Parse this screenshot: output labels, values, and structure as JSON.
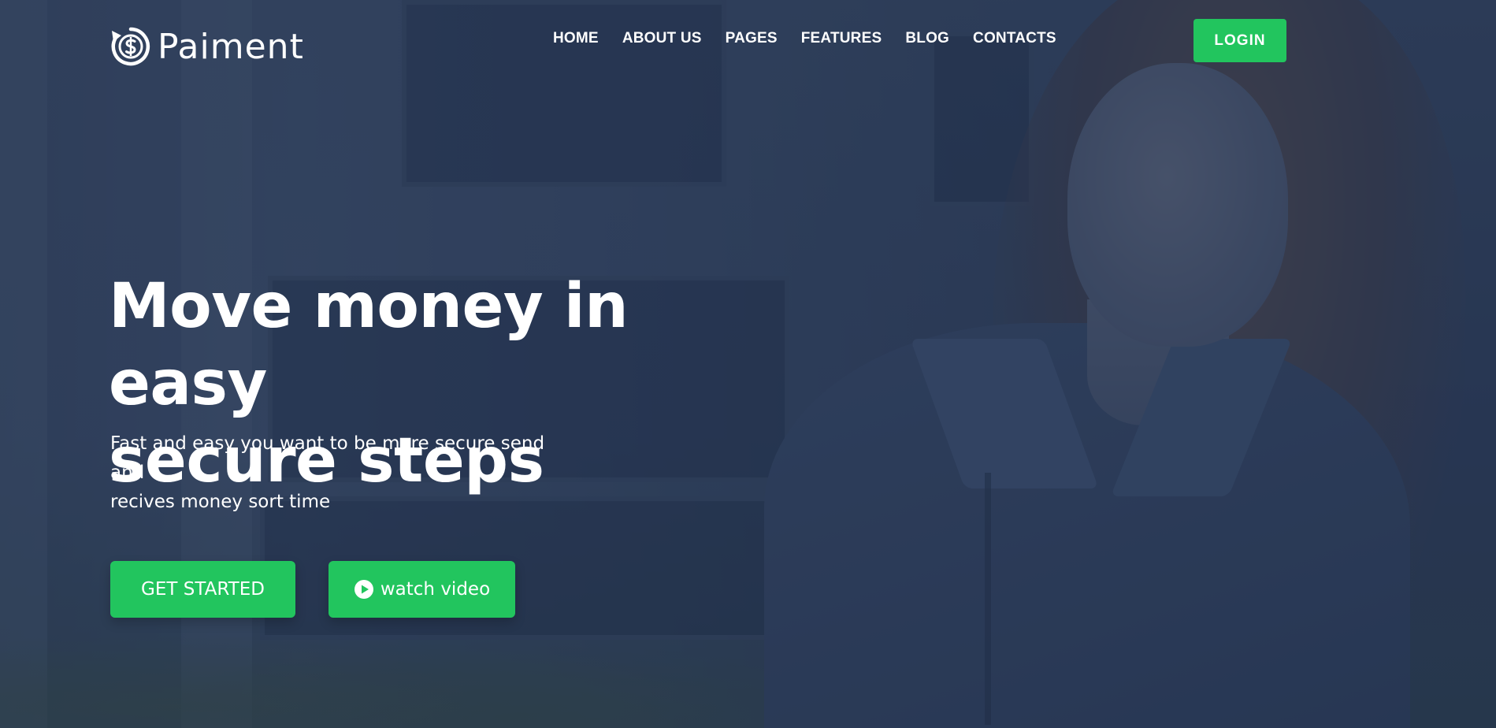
{
  "brand": {
    "name": "Paiment",
    "logo_icon": "dollar-refresh-icon"
  },
  "nav": {
    "items": [
      {
        "label": "HOME"
      },
      {
        "label": "ABOUT US"
      },
      {
        "label": "PAGES"
      },
      {
        "label": "FEATURES"
      },
      {
        "label": "BLOG"
      },
      {
        "label": "CONTACTS"
      }
    ],
    "login_label": "LOGIN"
  },
  "hero": {
    "headline_line1": "Move money in easy",
    "headline_line2": "secure steps",
    "subtext_line1": "Fast and easy you want to be more secure send and",
    "subtext_line2": "recives money sort time",
    "primary_cta": "GET STARTED",
    "secondary_cta": "watch video",
    "secondary_cta_icon": "play-circle-icon"
  },
  "colors": {
    "accent": "#22c55e",
    "overlay": "#253452",
    "text": "#ffffff"
  }
}
